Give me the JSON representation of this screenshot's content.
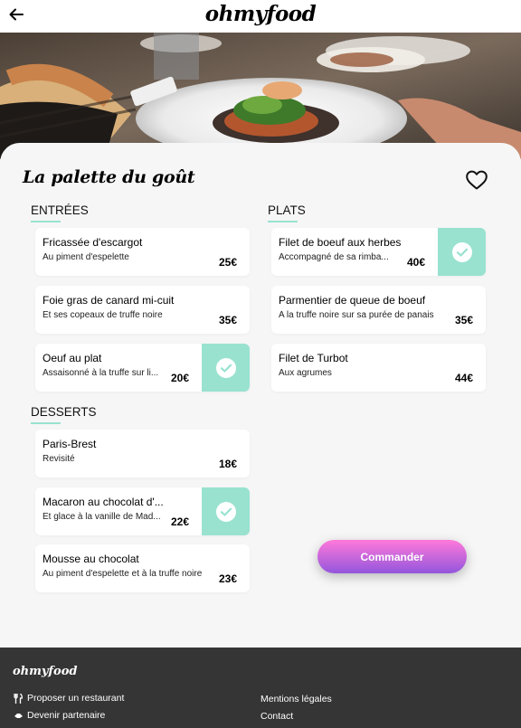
{
  "header": {
    "logo": "ohmyfood"
  },
  "restaurant": {
    "name": "La palette du goût"
  },
  "sections": {
    "entrees": {
      "title": "ENTRÉES",
      "dishes": [
        {
          "name": "Fricassée d'escargot",
          "desc": "Au piment d'espelette",
          "price": "25€"
        },
        {
          "name": "Foie gras de canard mi-cuit",
          "desc": "Et ses copeaux de truffe noire",
          "price": "35€"
        },
        {
          "name": "Oeuf au plat",
          "desc": "Assaisonné à la truffe sur li...",
          "price": "20€"
        }
      ]
    },
    "plats": {
      "title": "PLATS",
      "dishes": [
        {
          "name": "Filet de boeuf aux herbes",
          "desc": "Accompagné de sa rimba...",
          "price": "40€"
        },
        {
          "name": "Parmentier de queue de boeuf",
          "desc": "A la truffe noire sur sa purée de panais",
          "price": "35€"
        },
        {
          "name": "Filet de Turbot",
          "desc": "Aux agrumes",
          "price": "44€"
        }
      ]
    },
    "desserts": {
      "title": "DESSERTS",
      "dishes": [
        {
          "name": "Paris-Brest",
          "desc": "Revisité",
          "price": "18€"
        },
        {
          "name": "Macaron au chocolat d'...",
          "desc": "Et glace à la vanille de Mad...",
          "price": "22€"
        },
        {
          "name": "Mousse au chocolat",
          "desc": "Au piment d'espelette et à la truffe noire",
          "price": "23€"
        }
      ]
    }
  },
  "order_button": "Commander",
  "footer": {
    "logo": "ohmyfood",
    "links": {
      "propose": "Proposer un restaurant",
      "partner": "Devenir partenaire",
      "legal": "Mentions légales",
      "contact": "Contact"
    }
  },
  "colors": {
    "accent": "#99e2d0",
    "button_top": "#ff79da",
    "button_bottom": "#9356dc",
    "footer_bg": "#353535"
  }
}
